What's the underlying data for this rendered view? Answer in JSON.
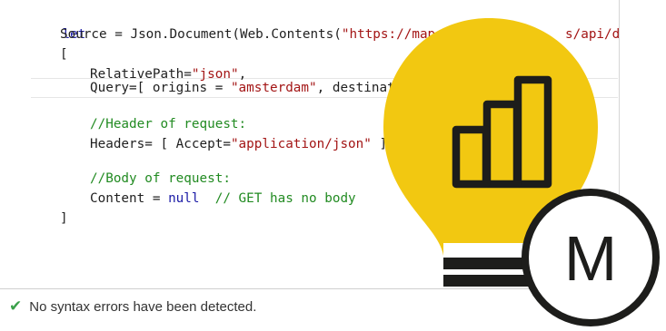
{
  "editor": {
    "kw_let": "let",
    "l2_pre": "Source = Json.Document(Web.Contents(",
    "l2_str": "\"https://maps.go",
    "l2_tail": "s/api/d",
    "l3": "[",
    "l4_pre": "RelativePath=",
    "l4_str": "\"json\"",
    "l4_post": ",",
    "l5_pre": "Query=[ origins = ",
    "l5_str": "\"amsterdam\"",
    "l5_post": ", destinations",
    "l7": "//Header of request:",
    "l8_pre": "Headers= [ Accept=",
    "l8_str": "\"application/json\"",
    "l8_post": " ],",
    "l10": "//Body of request:",
    "l11_pre": "Content = ",
    "l11_null": "null",
    "l11_com": "  // GET has no body",
    "l12": "]"
  },
  "status": {
    "text": "No syntax errors have been detected.",
    "icon": "checkmark-icon"
  },
  "logo": {
    "letter": "M"
  },
  "colors": {
    "bulb": "#f2c811",
    "keyword": "#1a1aa6",
    "string": "#a31515",
    "comment": "#228b22",
    "check": "#3aa04a"
  }
}
